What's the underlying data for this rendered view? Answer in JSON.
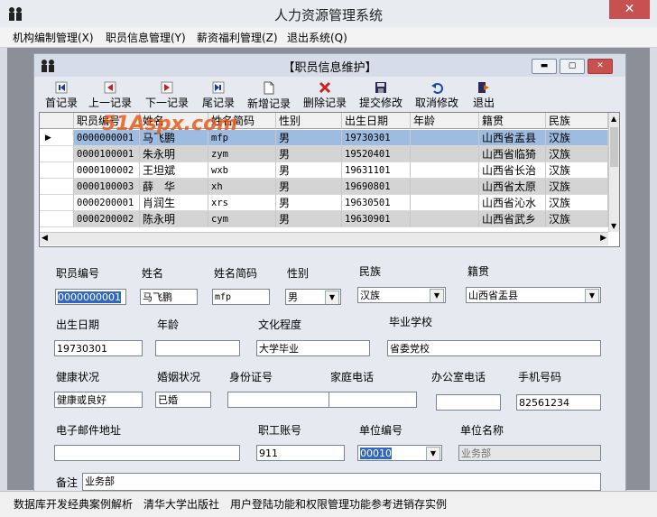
{
  "app": {
    "title": "人力资源管理系统",
    "close": "✕"
  },
  "menu": [
    "机构编制管理(X)",
    "职员信息管理(Y)",
    "薪资福利管理(Z)",
    "退出系统(Q)"
  ],
  "child": {
    "title": "【职员信息维护】",
    "min": "▬",
    "max": "▢",
    "close": "✕"
  },
  "toolbar": [
    {
      "label": "首记录",
      "icon": "first-icon"
    },
    {
      "label": "上一记录",
      "icon": "prev-icon"
    },
    {
      "label": "下一记录",
      "icon": "next-icon"
    },
    {
      "label": "尾记录",
      "icon": "last-icon"
    },
    {
      "label": "新增记录",
      "icon": "new-icon"
    },
    {
      "label": "删除记录",
      "icon": "delete-icon"
    },
    {
      "label": "提交修改",
      "icon": "save-icon"
    },
    {
      "label": "取消修改",
      "icon": "undo-icon"
    },
    {
      "label": "退出",
      "icon": "exit-icon"
    }
  ],
  "grid": {
    "columns": [
      "职员编号",
      "姓名",
      "姓名简码",
      "性别",
      "出生日期",
      "年龄",
      "籍贯",
      "民族"
    ],
    "rows": [
      [
        "0000000001",
        "马飞鹏",
        "mfp",
        "男",
        "19730301",
        "",
        "山西省盂县",
        "汉族"
      ],
      [
        "0000100001",
        "朱永明",
        "zym",
        "男",
        "19520401",
        "",
        "山西省临猗",
        "汉族"
      ],
      [
        "0000100002",
        "王坦斌",
        "wxb",
        "男",
        "19631101",
        "",
        "山西省长治",
        "汉族"
      ],
      [
        "0000100003",
        "薛　华",
        "xh",
        "男",
        "19690801",
        "",
        "山西省太原",
        "汉族"
      ],
      [
        "0000200001",
        "肖润生",
        "xrs",
        "男",
        "19630501",
        "",
        "山西省沁水",
        "汉族"
      ],
      [
        "0000200002",
        "陈永明",
        "cym",
        "男",
        "19630901",
        "",
        "山西省武乡",
        "汉族"
      ]
    ]
  },
  "watermark": "51Aspx.com",
  "form": {
    "emp_no_label": "职员编号",
    "emp_no": "0000000001",
    "name_label": "姓名",
    "name": "马飞鹏",
    "code_label": "姓名简码",
    "code": "mfp",
    "gender_label": "性别",
    "gender": "男",
    "nation_label": "民族",
    "nation": "汉族",
    "native_label": "籍贯",
    "native": "山西省盂县",
    "birth_label": "出生日期",
    "birth": "19730301",
    "age_label": "年龄",
    "age": "",
    "edu_label": "文化程度",
    "edu": "大学毕业",
    "school_label": "毕业学校",
    "school": "省委党校",
    "health_label": "健康状况",
    "health": "健康或良好",
    "marriage_label": "婚姻状况",
    "marriage": "已婚",
    "id_label": "身份证号",
    "id": "",
    "home_phone_label": "家庭电话",
    "home_phone": "",
    "office_phone_label": "办公室电话",
    "office_phone": "",
    "mobile_label": "手机号码",
    "mobile": "82561234",
    "email_label": "电子邮件地址",
    "email": "",
    "account_label": "职工账号",
    "account": "911",
    "unit_no_label": "单位编号",
    "unit_no": "00010",
    "unit_name_label": "单位名称",
    "unit_name": "业务部",
    "remark_label": "备注",
    "remark": "业务部"
  },
  "status": "数据库开发经典案例解析　清华大学出版社　用户登陆功能和权限管理功能参考进销存实例"
}
